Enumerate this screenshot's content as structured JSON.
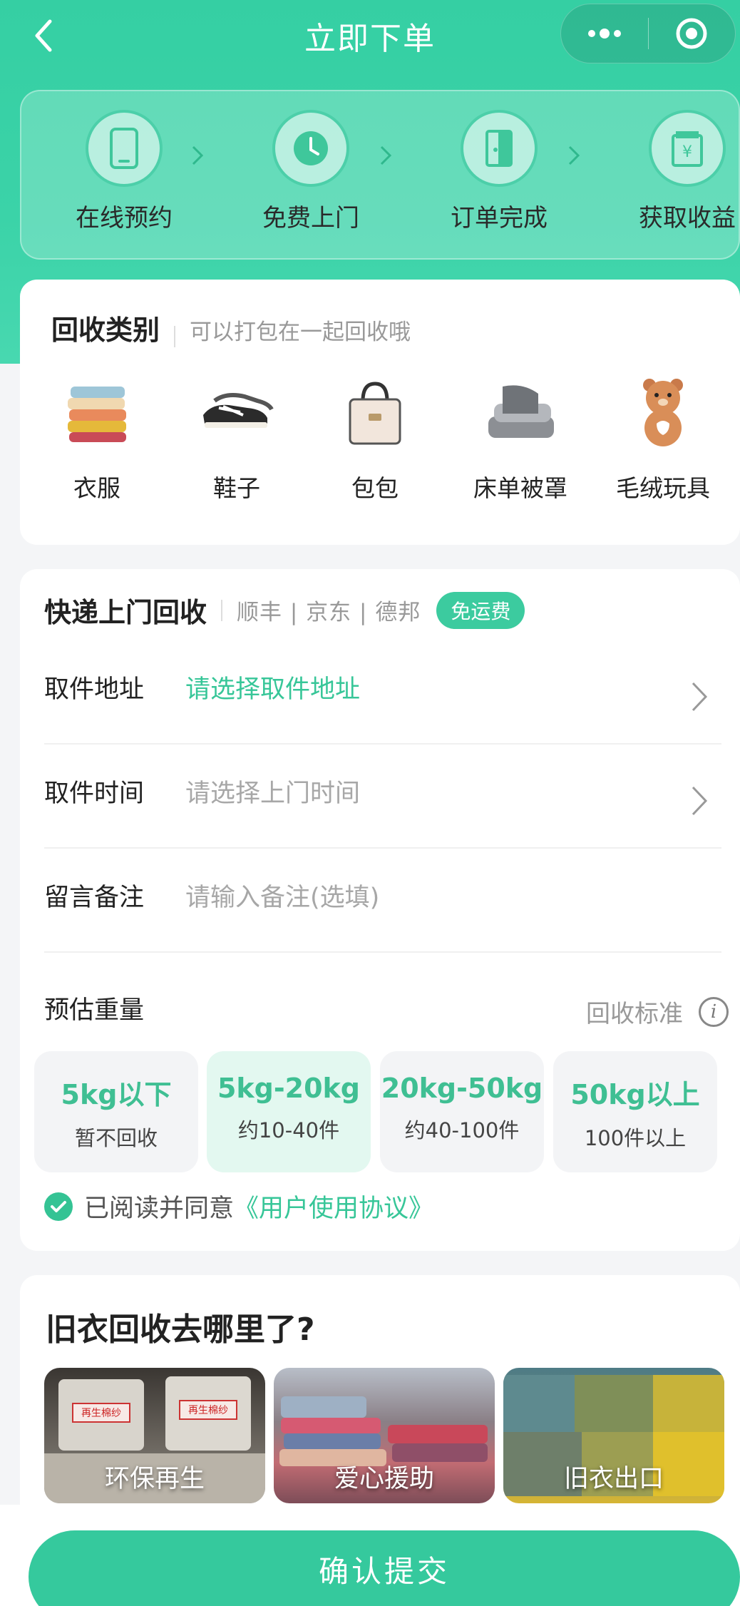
{
  "nav": {
    "title": "立即下单"
  },
  "steps": [
    {
      "label": "在线预约",
      "icon": "phone-icon"
    },
    {
      "label": "免费上门",
      "icon": "clock-icon"
    },
    {
      "label": "订单完成",
      "icon": "door-icon"
    },
    {
      "label": "获取收益",
      "icon": "wallet-icon"
    }
  ],
  "category": {
    "title": "回收类别",
    "subtitle": "可以打包在一起回收哦",
    "items": [
      {
        "label": "衣服",
        "icon": "clothes-icon"
      },
      {
        "label": "鞋子",
        "icon": "shoes-icon"
      },
      {
        "label": "包包",
        "icon": "bag-icon"
      },
      {
        "label": "床单被罩",
        "icon": "bedding-icon"
      },
      {
        "label": "毛绒玩具",
        "icon": "plush-toy-icon"
      }
    ]
  },
  "express": {
    "title": "快递上门回收",
    "carriers": "顺丰 | 京东 | 德邦",
    "badge": "免运费",
    "rows": [
      {
        "key": "取件地址",
        "value": "请选择取件地址"
      },
      {
        "key": "取件时间",
        "value": "请选择上门时间"
      },
      {
        "key": "留言备注",
        "value": "请输入备注(选填)"
      }
    ],
    "weight": {
      "label": "预估重量",
      "standard": "回收标准",
      "selected_index": 1,
      "options": [
        {
          "title": "5kg以下",
          "sub": "暂不回收"
        },
        {
          "title": "5kg-20kg",
          "sub": "约10-40件"
        },
        {
          "title": "20kg-50kg",
          "sub": "约40-100件"
        },
        {
          "title": "50kg以上",
          "sub": "100件以上"
        }
      ]
    },
    "agree": {
      "text": "已阅读并同意",
      "link": "《用户使用协议》",
      "checked": true
    }
  },
  "where": {
    "title": "旧衣回收去哪里了?",
    "items": [
      {
        "label": "环保再生",
        "tag": "再生棉纱"
      },
      {
        "label": "爱心援助"
      },
      {
        "label": "旧衣出口"
      }
    ]
  },
  "submit": {
    "label": "确认提交"
  },
  "colors": {
    "primary": "#35c99d",
    "link": "#37c698"
  }
}
